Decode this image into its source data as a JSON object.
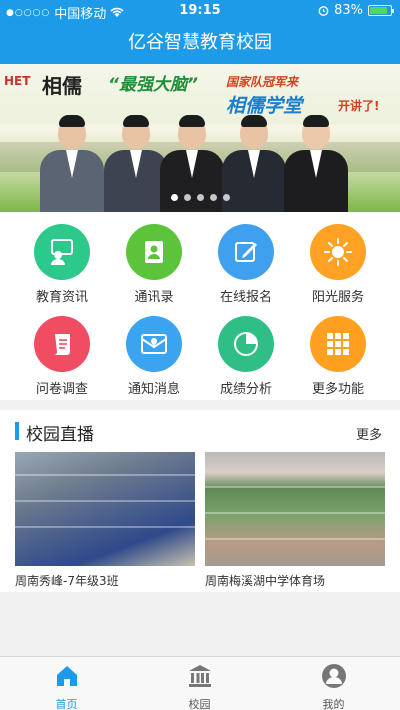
{
  "status": {
    "carrier": "中国移动",
    "time": "19:15",
    "battery": "83%",
    "battery_level": 0.83
  },
  "nav": {
    "title": "亿谷智慧教育校园"
  },
  "banner": {
    "logo_left": "HET",
    "logo_name": "相儒",
    "slogan_main": "“最强大脑”",
    "slogan_sub": "国家队冠军来",
    "slogan_brand": "相儒学堂",
    "slogan_end": "开讲了!",
    "colors": {
      "accent_blue": "#1e9be8"
    }
  },
  "grid": {
    "items": [
      {
        "label": "教育资讯",
        "icon": "news-chat-icon",
        "color": "#2dc98a"
      },
      {
        "label": "通讯录",
        "icon": "contacts-icon",
        "color": "#5cc43a"
      },
      {
        "label": "在线报名",
        "icon": "edit-form-icon",
        "color": "#3ea0ee"
      },
      {
        "label": "阳光服务",
        "icon": "sun-icon",
        "color": "#ffa224"
      },
      {
        "label": "问卷调查",
        "icon": "survey-scroll-icon",
        "color": "#f04d62"
      },
      {
        "label": "通知消息",
        "icon": "mail-notification-icon",
        "color": "#3aa4f0"
      },
      {
        "label": "成绩分析",
        "icon": "pie-chart-icon",
        "color": "#2fbf86"
      },
      {
        "label": "更多功能",
        "icon": "grid-more-icon",
        "color": "#ffa020"
      }
    ]
  },
  "live": {
    "title": "校园直播",
    "more": "更多",
    "videos": [
      {
        "caption": "周南秀峰-7年级3班"
      },
      {
        "caption": "周南梅溪湖中学体育场"
      }
    ]
  },
  "tabs": [
    {
      "label": "首页",
      "icon": "home-icon",
      "active": true
    },
    {
      "label": "校园",
      "icon": "school-building-icon",
      "active": false
    },
    {
      "label": "我的",
      "icon": "user-profile-icon",
      "active": false
    }
  ]
}
